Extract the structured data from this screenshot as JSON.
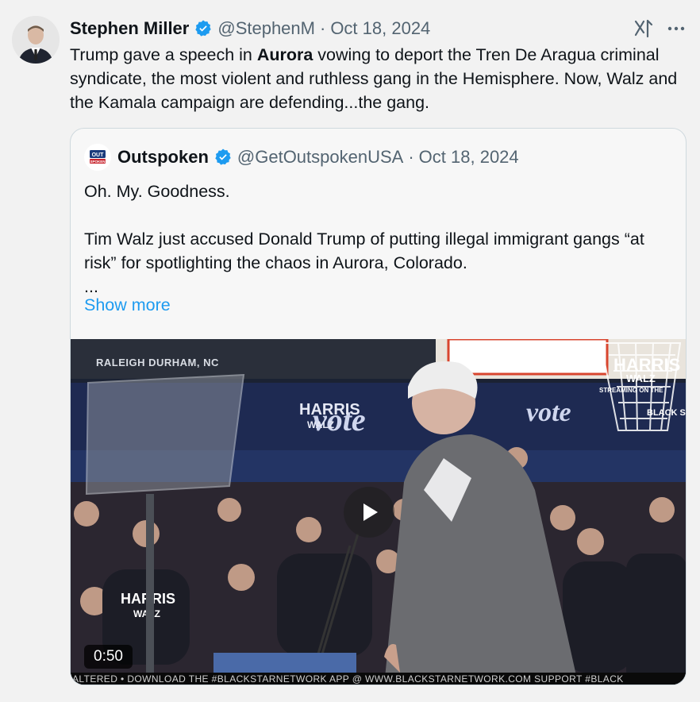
{
  "post": {
    "author_name": "Stephen Miller",
    "handle": "@StephenM",
    "separator": "·",
    "date": "Oct 18, 2024",
    "text_before": "Trump gave a speech in ",
    "text_bold": "Aurora",
    "text_after": " vowing to deport the Tren De Aragua criminal syndicate, the most violent and ruthless gang in the Hemisphere. Now, Walz and the Kamala campaign are defending...the gang.",
    "icons": {
      "avatar": "avatar-photo",
      "verified": "verified-badge-icon",
      "grok": "grok-icon",
      "more": "more-icon"
    }
  },
  "quote": {
    "author_name": "Outspoken",
    "handle": "@GetOutspokenUSA",
    "separator": "·",
    "date": "Oct 18, 2024",
    "line1": "Oh. My. Goodness.",
    "line2": "Tim Walz just accused Donald Trump of putting illegal immigrant gangs “at risk” for spotlighting the chaos in Aurora, Colorado.",
    "ellipsis": "...",
    "show_more": "Show more",
    "avatar_text_top": "OUT",
    "avatar_text_bottom": "SPOKEN"
  },
  "video": {
    "location": "RALEIGH DURHAM, NC",
    "duration": "0:50",
    "ticker": "ALTERED • DOWNLOAD THE #BLACKSTARNETWORK APP @  WWW.BLACKSTARNETWORK.COM SUPPORT #BLACK",
    "signs": {
      "harris": "HARRIS",
      "walz": "WALZ",
      "vote": "vote",
      "black_star": "BLACK STAR",
      "streaming": "STREAMING ON THE"
    }
  },
  "colors": {
    "link": "#1d9bf0",
    "verified": "#1d9bf0",
    "muted": "#536471"
  }
}
